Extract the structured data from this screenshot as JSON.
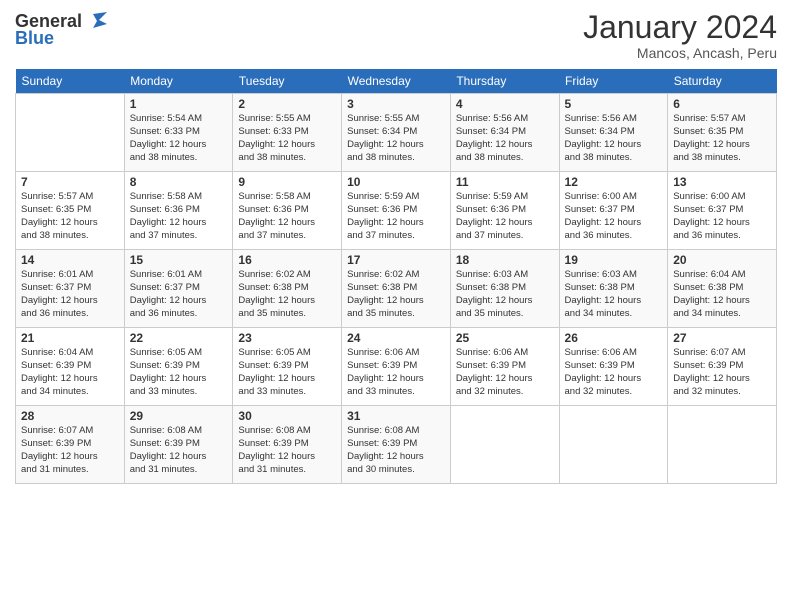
{
  "logo": {
    "general": "General",
    "blue": "Blue"
  },
  "header": {
    "month_year": "January 2024",
    "location": "Mancos, Ancash, Peru"
  },
  "days_of_week": [
    "Sunday",
    "Monday",
    "Tuesday",
    "Wednesday",
    "Thursday",
    "Friday",
    "Saturday"
  ],
  "weeks": [
    [
      {
        "day": "",
        "info": ""
      },
      {
        "day": "1",
        "info": "Sunrise: 5:54 AM\nSunset: 6:33 PM\nDaylight: 12 hours\nand 38 minutes."
      },
      {
        "day": "2",
        "info": "Sunrise: 5:55 AM\nSunset: 6:33 PM\nDaylight: 12 hours\nand 38 minutes."
      },
      {
        "day": "3",
        "info": "Sunrise: 5:55 AM\nSunset: 6:34 PM\nDaylight: 12 hours\nand 38 minutes."
      },
      {
        "day": "4",
        "info": "Sunrise: 5:56 AM\nSunset: 6:34 PM\nDaylight: 12 hours\nand 38 minutes."
      },
      {
        "day": "5",
        "info": "Sunrise: 5:56 AM\nSunset: 6:34 PM\nDaylight: 12 hours\nand 38 minutes."
      },
      {
        "day": "6",
        "info": "Sunrise: 5:57 AM\nSunset: 6:35 PM\nDaylight: 12 hours\nand 38 minutes."
      }
    ],
    [
      {
        "day": "7",
        "info": "Sunrise: 5:57 AM\nSunset: 6:35 PM\nDaylight: 12 hours\nand 38 minutes."
      },
      {
        "day": "8",
        "info": "Sunrise: 5:58 AM\nSunset: 6:36 PM\nDaylight: 12 hours\nand 37 minutes."
      },
      {
        "day": "9",
        "info": "Sunrise: 5:58 AM\nSunset: 6:36 PM\nDaylight: 12 hours\nand 37 minutes."
      },
      {
        "day": "10",
        "info": "Sunrise: 5:59 AM\nSunset: 6:36 PM\nDaylight: 12 hours\nand 37 minutes."
      },
      {
        "day": "11",
        "info": "Sunrise: 5:59 AM\nSunset: 6:36 PM\nDaylight: 12 hours\nand 37 minutes."
      },
      {
        "day": "12",
        "info": "Sunrise: 6:00 AM\nSunset: 6:37 PM\nDaylight: 12 hours\nand 36 minutes."
      },
      {
        "day": "13",
        "info": "Sunrise: 6:00 AM\nSunset: 6:37 PM\nDaylight: 12 hours\nand 36 minutes."
      }
    ],
    [
      {
        "day": "14",
        "info": "Sunrise: 6:01 AM\nSunset: 6:37 PM\nDaylight: 12 hours\nand 36 minutes."
      },
      {
        "day": "15",
        "info": "Sunrise: 6:01 AM\nSunset: 6:37 PM\nDaylight: 12 hours\nand 36 minutes."
      },
      {
        "day": "16",
        "info": "Sunrise: 6:02 AM\nSunset: 6:38 PM\nDaylight: 12 hours\nand 35 minutes."
      },
      {
        "day": "17",
        "info": "Sunrise: 6:02 AM\nSunset: 6:38 PM\nDaylight: 12 hours\nand 35 minutes."
      },
      {
        "day": "18",
        "info": "Sunrise: 6:03 AM\nSunset: 6:38 PM\nDaylight: 12 hours\nand 35 minutes."
      },
      {
        "day": "19",
        "info": "Sunrise: 6:03 AM\nSunset: 6:38 PM\nDaylight: 12 hours\nand 34 minutes."
      },
      {
        "day": "20",
        "info": "Sunrise: 6:04 AM\nSunset: 6:38 PM\nDaylight: 12 hours\nand 34 minutes."
      }
    ],
    [
      {
        "day": "21",
        "info": "Sunrise: 6:04 AM\nSunset: 6:39 PM\nDaylight: 12 hours\nand 34 minutes."
      },
      {
        "day": "22",
        "info": "Sunrise: 6:05 AM\nSunset: 6:39 PM\nDaylight: 12 hours\nand 33 minutes."
      },
      {
        "day": "23",
        "info": "Sunrise: 6:05 AM\nSunset: 6:39 PM\nDaylight: 12 hours\nand 33 minutes."
      },
      {
        "day": "24",
        "info": "Sunrise: 6:06 AM\nSunset: 6:39 PM\nDaylight: 12 hours\nand 33 minutes."
      },
      {
        "day": "25",
        "info": "Sunrise: 6:06 AM\nSunset: 6:39 PM\nDaylight: 12 hours\nand 32 minutes."
      },
      {
        "day": "26",
        "info": "Sunrise: 6:06 AM\nSunset: 6:39 PM\nDaylight: 12 hours\nand 32 minutes."
      },
      {
        "day": "27",
        "info": "Sunrise: 6:07 AM\nSunset: 6:39 PM\nDaylight: 12 hours\nand 32 minutes."
      }
    ],
    [
      {
        "day": "28",
        "info": "Sunrise: 6:07 AM\nSunset: 6:39 PM\nDaylight: 12 hours\nand 31 minutes."
      },
      {
        "day": "29",
        "info": "Sunrise: 6:08 AM\nSunset: 6:39 PM\nDaylight: 12 hours\nand 31 minutes."
      },
      {
        "day": "30",
        "info": "Sunrise: 6:08 AM\nSunset: 6:39 PM\nDaylight: 12 hours\nand 31 minutes."
      },
      {
        "day": "31",
        "info": "Sunrise: 6:08 AM\nSunset: 6:39 PM\nDaylight: 12 hours\nand 30 minutes."
      },
      {
        "day": "",
        "info": ""
      },
      {
        "day": "",
        "info": ""
      },
      {
        "day": "",
        "info": ""
      }
    ]
  ]
}
